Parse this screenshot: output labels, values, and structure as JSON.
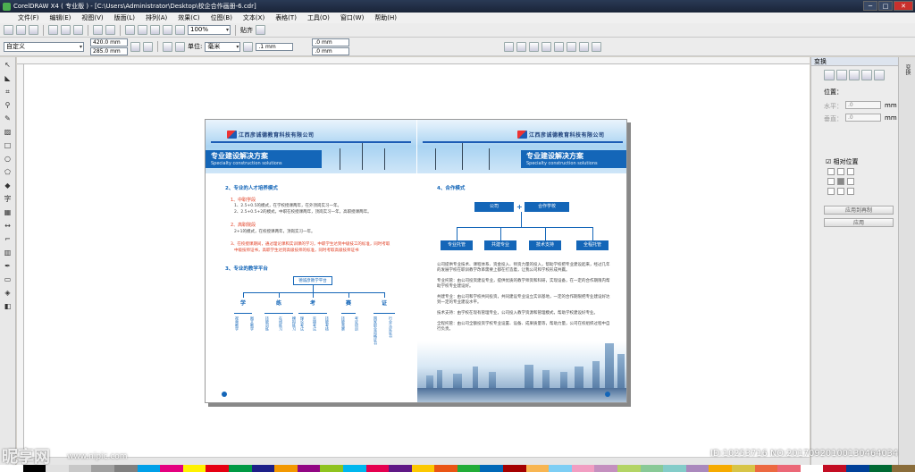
{
  "window": {
    "title": "CorelDRAW X4 ( 专业版 ) - [C:\\Users\\Administrator\\Desktop\\校企合作画册-6.cdr]",
    "min": "─",
    "max": "□",
    "close": "✕"
  },
  "menu": [
    "文件(F)",
    "编辑(E)",
    "视图(V)",
    "版面(L)",
    "排列(A)",
    "效果(C)",
    "位图(B)",
    "文本(X)",
    "表格(T)",
    "工具(O)",
    "窗口(W)",
    "帮助(H)"
  ],
  "toolbar1": {
    "zoom": "100%",
    "snap": "贴齐"
  },
  "toolbar2": {
    "paper": "自定义",
    "width": "420.0 mm",
    "height": "285.0 mm",
    "units_label": "单位:",
    "units": "毫米",
    "nudge": ".1 mm",
    "dup_x": ".0 mm",
    "dup_y": ".0 mm"
  },
  "left_page": {
    "logo": "江西彦诚德教育科技有限公司",
    "banner_title": "专业建设解决方案",
    "banner_sub": "Specialty construction solutions",
    "sec2": "2、专业的人才培养模式",
    "sub1": "1、中职学段",
    "sub1_lines": [
      "1、2.5+0.5的模式，在学校授课两年，在外顶岗实习一年。",
      "2、2.5+0.5+2的模式，中职在校授课两年，顶岗实习一年，高职授课两年。"
    ],
    "sub2": "2、高职院段",
    "sub2_lines": [
      "2+1的模式，在校授课两年，顶岗实习一年。"
    ],
    "sub3_lines": [
      "3、在校授课期间，通过理论课和实训课的学习，中职学生达到中级技工的标准，同时考取",
      "中级技师证书，高职学生达到高级技师的标准，同时考取高级技师证书"
    ],
    "sec3": "3、专业的教学平台",
    "platform_root": "德诚彦教学平台",
    "platform_chars": [
      "学",
      "练",
      "考",
      "赛",
      "证"
    ],
    "platform_leaves": [
      "视频教学",
      "图文教学",
      "技能训练",
      "在线练习",
      "模拟练习",
      "理论考试",
      "实操考试",
      "技能考核",
      "技能竞赛",
      "考证培训",
      "国家职业资格证书",
      "行业认证证书"
    ]
  },
  "right_page": {
    "logo": "江西彦诚德教育科技有限公司",
    "banner_title": "专业建设解决方案",
    "banner_sub": "Specialty construction solutions",
    "sec4": "4、合作模式",
    "top_boxes": [
      "公司",
      "合作学校"
    ],
    "plus": "+",
    "bottom_boxes": [
      "专业托管",
      "共建专业",
      "技术支持",
      "全程托管"
    ],
    "para": [
      "公司提供专业技术、课程体系、资金投入、师资力量的投入，帮助学校把专业建设起来，经过几年的发展学校在职训教学改革需要上都在打造着，让我公司和学校形成共赢。",
      "专业托管：由公司投资建设专业，提供优质的教学师资和科研，实现设备，在一定的合作期限内帮助学校专业建设好。",
      "共建专业：由公司和学校共同投资，共同建设专业设立实训基地，一定的合作期限把专业建设好达到一定的专业建设水平。",
      "技术支持：由学校在现有管理专业，公司投入教学资源和管理模式，帮助学校建设好专业。",
      "全程托管：由公司全额投资学校专业设置、设备、成果质量等，帮助力量，公司在校组织过程中自行负责。"
    ]
  },
  "transform_panel": {
    "title": "变换",
    "position_label": "位置：",
    "h_label": "水平：",
    "v_label": "垂直：",
    "h_value": ".0",
    "v_value": ".0",
    "unit": "mm",
    "relative": "相对位置",
    "apply_dup": "应用到再制",
    "apply": "应用"
  },
  "dock_tab": "变换",
  "watermark": {
    "brand": "昵享网",
    "url": "www.nipic.com",
    "id": "ID:10253716 NO:20170920100130464034"
  },
  "palette": [
    "#ffffff",
    "#000000",
    "#e0e0e0",
    "#c8c8c8",
    "#a0a0a0",
    "#808080",
    "#00a0e9",
    "#e4007f",
    "#fff100",
    "#e60012",
    "#009944",
    "#1d2088",
    "#f39800",
    "#920783",
    "#8fc31f",
    "#00b7ee",
    "#e5004f",
    "#601986",
    "#fcc800",
    "#ea5514",
    "#22ac38",
    "#0068b7",
    "#a40000",
    "#f8b551",
    "#7ecef4",
    "#f19ec2",
    "#c490bf",
    "#b3d465",
    "#89c997",
    "#84ccc9",
    "#aa89bd",
    "#f6ab00",
    "#d7c447",
    "#ec6941",
    "#eb6877",
    "#ffffff",
    "#c30d23",
    "#004098",
    "#006934",
    "#8a6d3b"
  ]
}
